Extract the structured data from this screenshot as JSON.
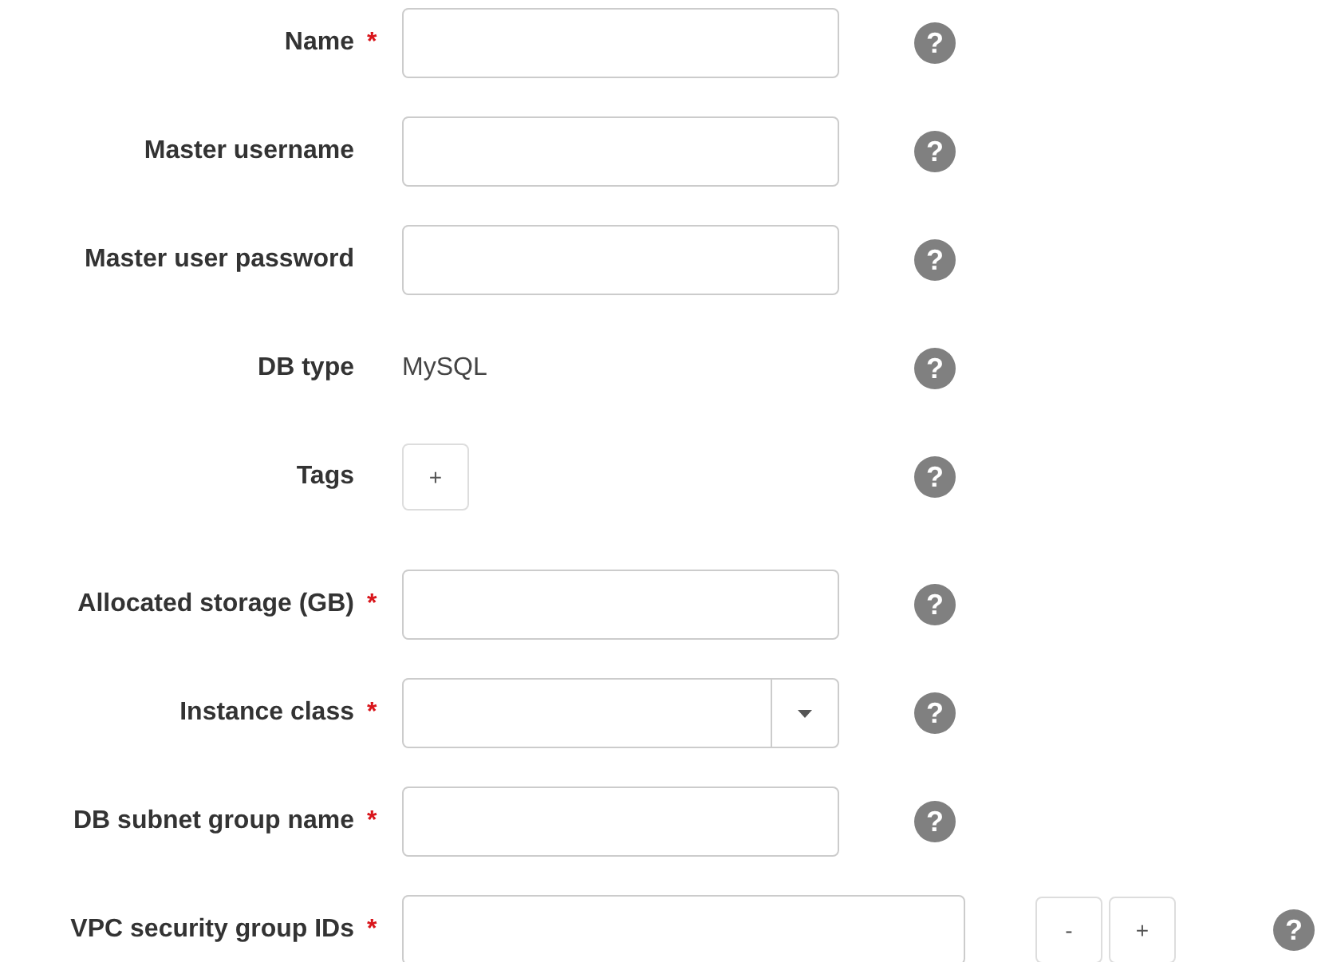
{
  "fields": [
    {
      "kind": "text",
      "label": "Name",
      "required_mark": "*",
      "help": "?"
    },
    {
      "kind": "text",
      "label": "Master username",
      "help": "?"
    },
    {
      "kind": "text",
      "label": "Master user password",
      "help": "?"
    },
    {
      "kind": "static",
      "label": "DB type",
      "value": "MySQL",
      "help": "?"
    },
    {
      "kind": "tags",
      "label": "Tags",
      "button": "+",
      "help": "?"
    },
    {
      "kind": "text",
      "label": "Allocated storage (GB)",
      "required_mark": "*",
      "help": "?"
    },
    {
      "kind": "select",
      "label": "Instance class",
      "required_mark": "*",
      "help": "?"
    },
    {
      "kind": "text",
      "label": "DB subnet group name",
      "required_mark": "*",
      "help": "?"
    },
    {
      "kind": "list",
      "label": "VPC security group IDs",
      "required_mark": "*",
      "buttons": [
        "-",
        "+"
      ],
      "help": "?"
    }
  ]
}
